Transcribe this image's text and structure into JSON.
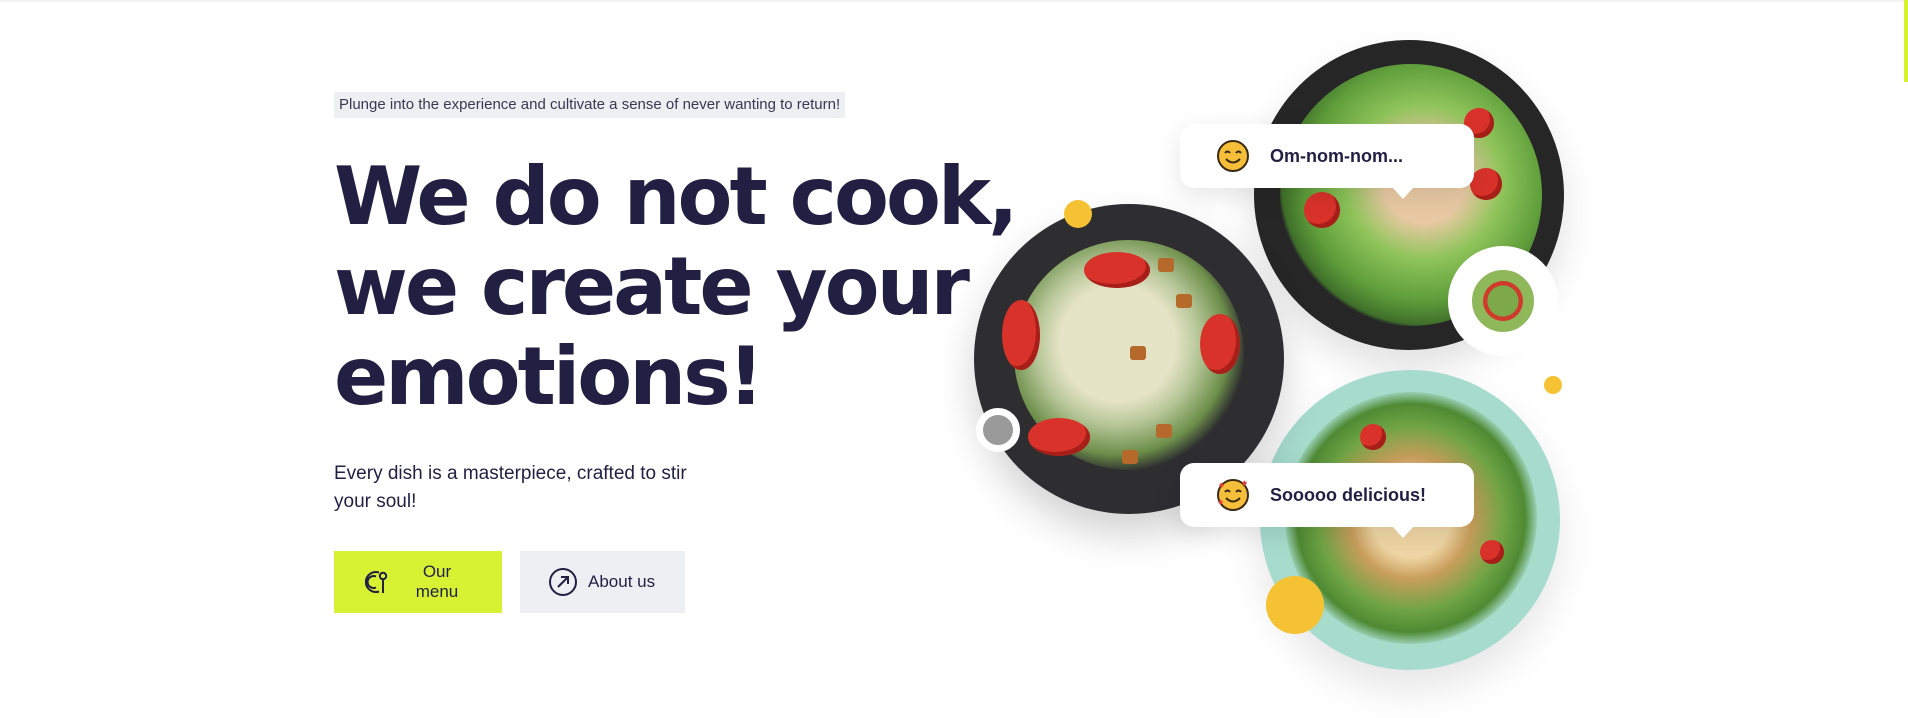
{
  "hero": {
    "tagline": "Plunge into the experience and cultivate a sense of never wanting to return!",
    "headline_lines": [
      "We do not cook,",
      "we create your",
      "emotions!"
    ],
    "subtext": "Every dish is a masterpiece, crafted to stir your soul!",
    "buttons": {
      "menu_label": "Our menu",
      "menu_icon": "fork-plate-icon",
      "about_label": "About us",
      "about_icon": "arrow-up-right-circle-icon"
    }
  },
  "bubbles": [
    {
      "text": "Om-nom-nom...",
      "emoji": "smiling-face-icon"
    },
    {
      "text": "Sooooo delicious!",
      "emoji": "face-with-hearts-icon"
    }
  ],
  "colors": {
    "accent": "#d7f232",
    "heading": "#221f42",
    "dot": "#f4c233",
    "button_secondary": "#eeeff3"
  }
}
